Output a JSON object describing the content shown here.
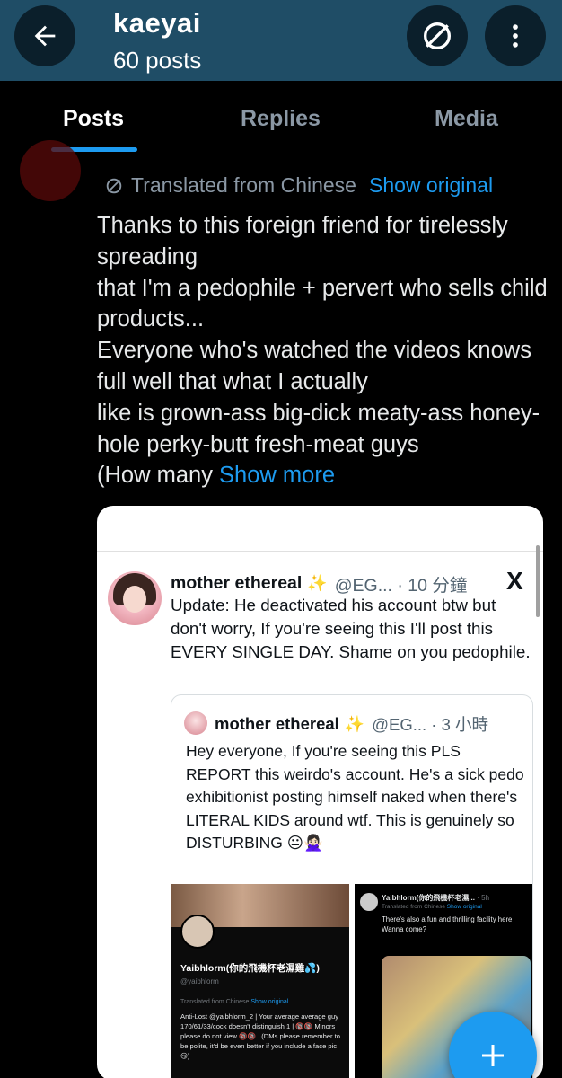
{
  "header": {
    "title": "kaeyai",
    "post_count": "60 posts"
  },
  "tabs": [
    "Posts",
    "Replies",
    "Media"
  ],
  "colors": {
    "header_bg": "#1f4d66",
    "accent": "#1d9bf0",
    "bg": "#000000"
  },
  "icons": [
    "back-arrow-icon",
    "no-symbol-icon",
    "more-vertical-icon",
    "translate-icon",
    "x-logo-icon",
    "plus-icon"
  ],
  "post": {
    "translated_label": "Translated from Chinese",
    "show_original": "Show original",
    "body": "Thanks to this foreign friend for tirelessly spreading\nthat I'm a pedophile + pervert who sells child products...\nEveryone who's watched the videos knows full well that what I actually\nlike is grown-ass big-dick meaty-ass honey-hole perky-butt fresh-meat guys\n(How many",
    "show_more": "Show more"
  },
  "card": {
    "quote": {
      "name": "mother ethereal",
      "handle_time": "@EG... · 10 分鐘",
      "x_logo": "X",
      "text": "Update: He deactivated his account btw but don't worry, If you're seeing this I'll post this EVERY SINGLE DAY. Shame on you pedophile."
    },
    "inner": {
      "name": "mother ethereal",
      "handle_time": "@EG... · 3 小時",
      "text": "Hey everyone, If you're seeing this PLS REPORT this weirdo's account. He's a sick pedo exhibitionist posting himself naked when there's LITERAL KIDS around wtf. This is genuinely so DISTURBING 😐🙅🏻‍♀️"
    },
    "shot1": {
      "name": "Yaibhlorm(你的飛機杯老濕雞💦)",
      "handle": "@yaibhlorm",
      "translated": "Translated from Chinese",
      "show_original": "Show original",
      "bio": "Anti-Lost @yaibhlorm_2 | Your average average guy 170/61/33/cock doesn't distinguish 1 | 🔞🔞 Minors please do not view 🔞🔞 . (DMs please remember to be polite, it'd be even better if you include a face pic 😏)"
    },
    "shot2": {
      "name": "Yaibhlorm(你的飛機杯老濕...",
      "time": "· 5h",
      "translated": "Translated from Chinese",
      "show_original": "Show original",
      "text": "There's also a fun and thrilling facility here\nWanna come?"
    }
  }
}
